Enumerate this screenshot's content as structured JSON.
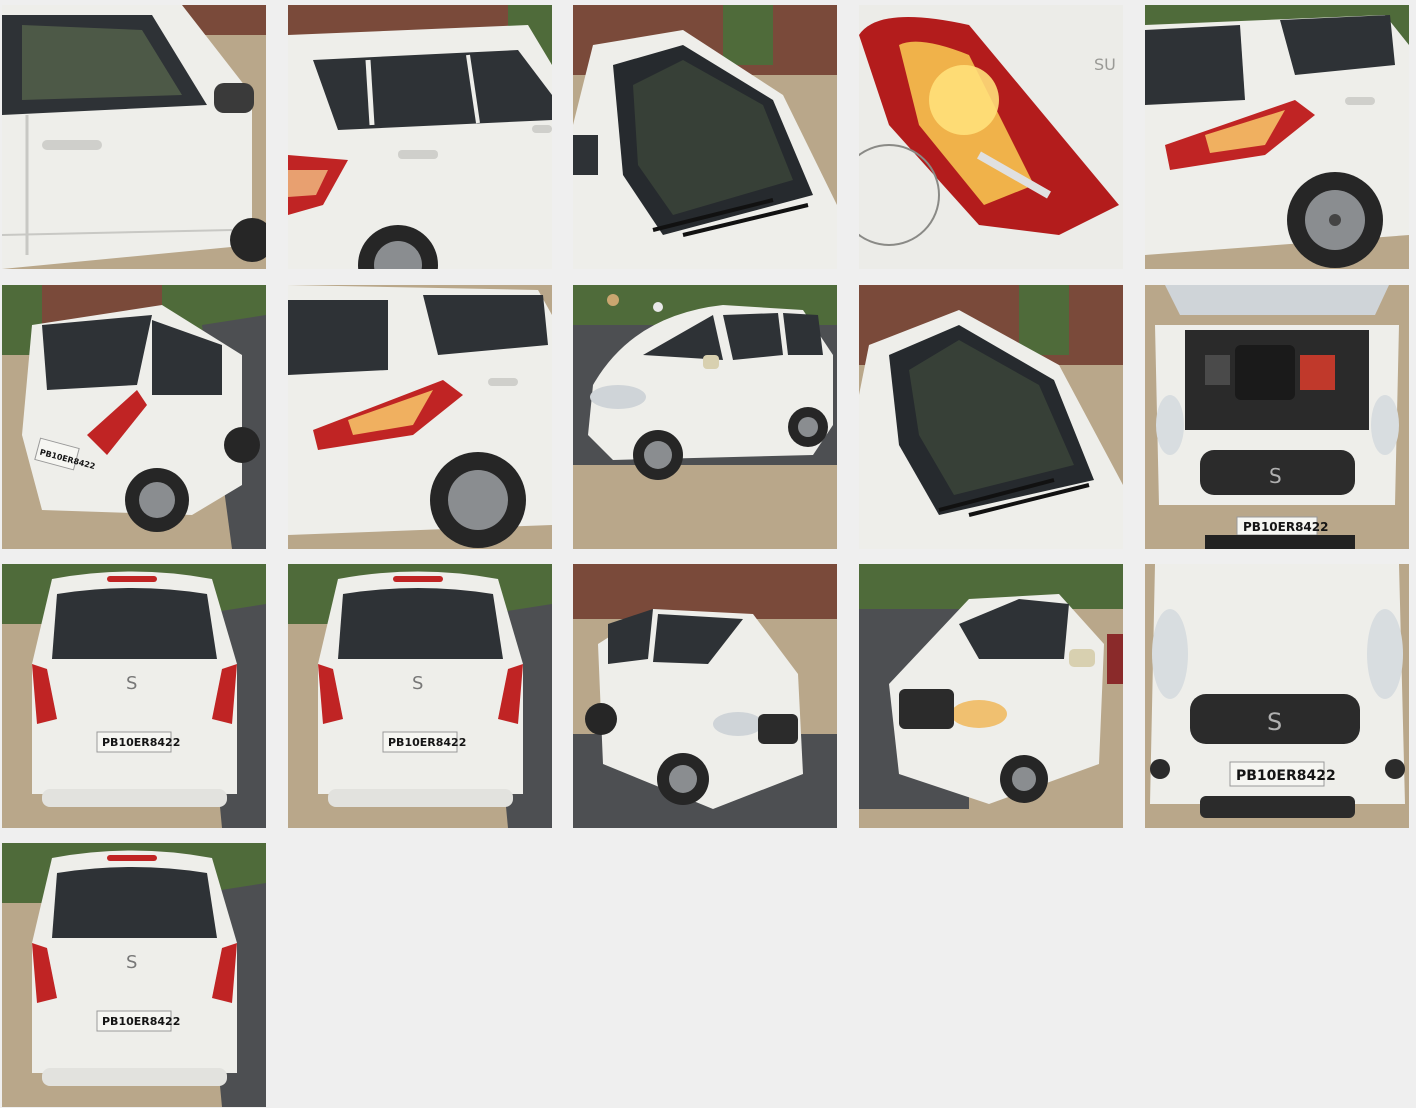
{
  "gallery": {
    "photos": [
      {
        "subject": "side-door-closeup"
      },
      {
        "subject": "rear-door-side-view"
      },
      {
        "subject": "windshield-closeup"
      },
      {
        "subject": "tail-light-closeup"
      },
      {
        "subject": "rear-quarter-view"
      },
      {
        "subject": "rear-three-quarter-view",
        "plate": "PB10ER8422"
      },
      {
        "subject": "rear-quarter-view"
      },
      {
        "subject": "front-three-quarter-street-view"
      },
      {
        "subject": "windshield-closeup"
      },
      {
        "subject": "engine-bay-open-hood",
        "plate": "PB10ER8422"
      },
      {
        "subject": "rear-view",
        "plate": "PB10ER8422"
      },
      {
        "subject": "rear-view",
        "plate": "PB10ER8422"
      },
      {
        "subject": "front-three-quarter-view"
      },
      {
        "subject": "front-three-quarter-view"
      },
      {
        "subject": "front-grille-view",
        "plate": "PB10ER8422"
      },
      {
        "subject": "rear-view",
        "plate": "PB10ER8422"
      }
    ]
  },
  "colors": {
    "background": "#efefef",
    "car_white": "#eeeeea",
    "glass": "#2e3236",
    "tail_light": "#c02424",
    "road": "#4d4f52",
    "ground": "#b9a78a",
    "wall": "#7a4a3a",
    "foliage": "#4f6b3a"
  }
}
